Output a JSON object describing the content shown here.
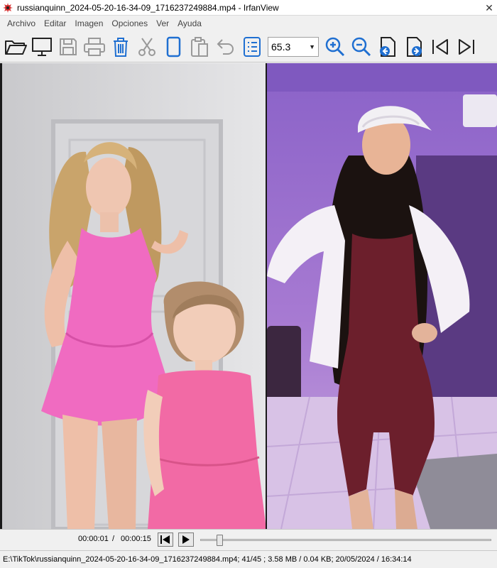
{
  "window": {
    "title": "russianquinn_2024-05-20-16-34-09_1716237249884.mp4 - IrfanView",
    "close_glyph": "✕"
  },
  "menu": {
    "items": [
      "Archivo",
      "Editar",
      "Imagen",
      "Opciones",
      "Ver",
      "Ayuda"
    ]
  },
  "toolbar": {
    "zoom_value": "65.3",
    "icons": [
      "open-folder-icon",
      "slideshow-monitor-icon",
      "save-icon",
      "print-icon",
      "delete-icon",
      "cut-icon",
      "copy-icon",
      "paste-icon",
      "undo-icon",
      "properties-icon",
      "zoom-in-icon",
      "zoom-out-icon",
      "page-prev-icon",
      "page-next-icon",
      "previous-file-icon",
      "next-file-icon"
    ],
    "accent_color": "#1f6fd1"
  },
  "playback": {
    "current_time": "00:00:01",
    "separator": "/",
    "total_time": "00:00:15",
    "seek_position": 0.067
  },
  "status": {
    "text": "E:\\TikTok\\russianquinn_2024-05-20-16-34-09_1716237249884.mp4; 41/45 ; 3.58 MB / 0.04 KB; 20/05/2024 / 16:34:14"
  }
}
